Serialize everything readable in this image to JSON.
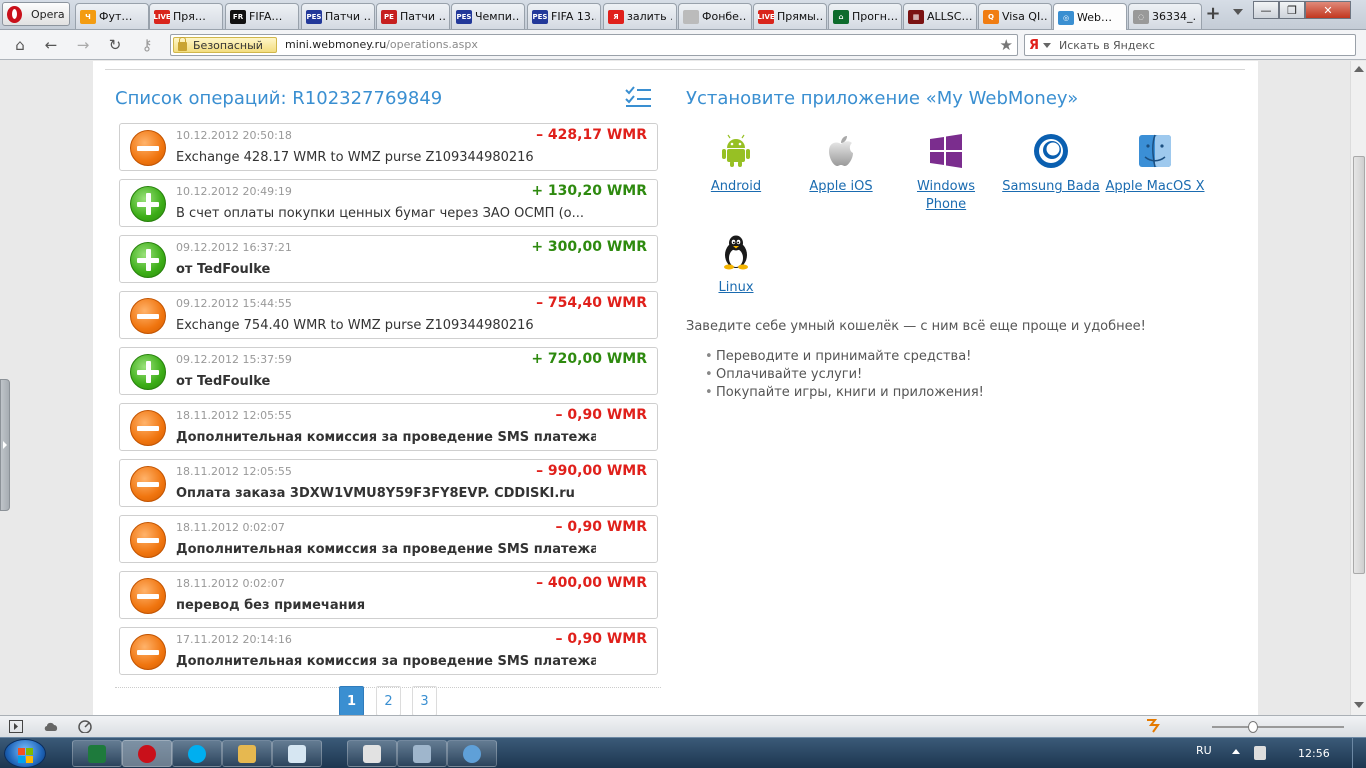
{
  "browser": {
    "opera_label": "Opera",
    "tabs": [
      {
        "label": "Фут…",
        "color": "#f39c12",
        "glyph": "Ч"
      },
      {
        "label": "Пря…",
        "color": "#d9251c",
        "glyph": "LIVE"
      },
      {
        "label": "FIFA…",
        "color": "#111111",
        "glyph": "FR"
      },
      {
        "label": "Патчи …",
        "color": "#23399a",
        "glyph": "PES"
      },
      {
        "label": "Патчи …",
        "color": "#c61f1f",
        "glyph": "PE"
      },
      {
        "label": "Чемпи…",
        "color": "#23399a",
        "glyph": "PES"
      },
      {
        "label": "FIFA 13…",
        "color": "#23399a",
        "glyph": "PES"
      },
      {
        "label": "залить …",
        "color": "#e0201b",
        "glyph": "Я"
      },
      {
        "label": "Фонбе…",
        "color": "#bbbbbb",
        "glyph": ""
      },
      {
        "label": "Прямы…",
        "color": "#d9251c",
        "glyph": "LIVE"
      },
      {
        "label": "Прогн…",
        "color": "#0d6b2c",
        "glyph": "⌂"
      },
      {
        "label": "ALLSC…",
        "color": "#7a1212",
        "glyph": "▦"
      },
      {
        "label": "Visa QI…",
        "color": "#f07d13",
        "glyph": "Q"
      },
      {
        "label": "Web…",
        "color": "#3a8fd1",
        "glyph": "◎",
        "active": true
      },
      {
        "label": "36334_…",
        "color": "#999999",
        "glyph": "◌"
      }
    ],
    "secure_label": "Безопасный",
    "url_host": "mini.webmoney.ru",
    "url_path": "/operations.aspx",
    "search_brand": "Я",
    "search_placeholder": "Искать в Яндекс"
  },
  "operations": {
    "title": "Список операций: R102327769849",
    "items": [
      {
        "date": "10.12.2012 20:50:18",
        "amount": "– 428,17 WMR",
        "desc": "Exchange 428.17 WMR to WMZ purse Z109344980216",
        "type": "minus",
        "bold": false
      },
      {
        "date": "10.12.2012 20:49:19",
        "amount": "+ 130,20 WMR",
        "desc": "В счет оплаты покупки ценных бумаг через ЗАО ОСМП (о...",
        "type": "plus",
        "bold": false
      },
      {
        "date": "09.12.2012 16:37:21",
        "amount": "+ 300,00 WMR",
        "desc": "от TedFoulke",
        "type": "plus",
        "bold": true
      },
      {
        "date": "09.12.2012 15:44:55",
        "amount": "– 754,40 WMR",
        "desc": "Exchange 754.40 WMR to WMZ purse Z109344980216",
        "type": "minus",
        "bold": false
      },
      {
        "date": "09.12.2012 15:37:59",
        "amount": "+ 720,00 WMR",
        "desc": "от TedFoulke",
        "type": "plus",
        "bold": true
      },
      {
        "date": "18.11.2012 12:05:55",
        "amount": "– 0,90 WMR",
        "desc": "Дополнительная комиссия за проведение SMS платежа но...",
        "type": "minus",
        "bold": true
      },
      {
        "date": "18.11.2012 12:05:55",
        "amount": "– 990,00 WMR",
        "desc": "Оплата заказа 3DXW1VMU8Y59F3FY8EVP. CDDISKI.ru",
        "type": "minus",
        "bold": true
      },
      {
        "date": "18.11.2012 0:02:07",
        "amount": "– 0,90 WMR",
        "desc": "Дополнительная комиссия за проведение SMS платежа но...",
        "type": "minus",
        "bold": true
      },
      {
        "date": "18.11.2012 0:02:07",
        "amount": "– 400,00 WMR",
        "desc": "перевод без примечания",
        "type": "minus",
        "bold": true
      },
      {
        "date": "17.11.2012 20:14:16",
        "amount": "– 0,90 WMR",
        "desc": "Дополнительная комиссия за проведение SMS платежа но...",
        "type": "minus",
        "bold": true
      }
    ],
    "pages": [
      "1",
      "2",
      "3"
    ],
    "active_page": "1"
  },
  "promo": {
    "title": "Установите приложение «My WebMoney»",
    "apps": [
      {
        "label": "Android",
        "icon": "android-icon"
      },
      {
        "label": "Apple iOS",
        "icon": "apple-icon"
      },
      {
        "label": "Windows Phone",
        "icon": "windows-icon"
      },
      {
        "label": "Samsung Bada",
        "icon": "bada-icon"
      },
      {
        "label": "Apple MacOS X",
        "icon": "finder-icon"
      },
      {
        "label": "Linux",
        "icon": "tux-icon"
      }
    ],
    "text": "Заведите себе умный кошелёк — с ним всё еще проще и удобнее!",
    "features": [
      "Переводите и принимайте средства!",
      "Оплачивайте услуги!",
      "Покупайте игры, книги и приложения!"
    ]
  },
  "taskbar": {
    "language": "RU",
    "clock": "12:56"
  },
  "colors": {
    "accent": "#3a8fd1",
    "negative": "#e0201b",
    "positive": "#2e8a0f"
  }
}
